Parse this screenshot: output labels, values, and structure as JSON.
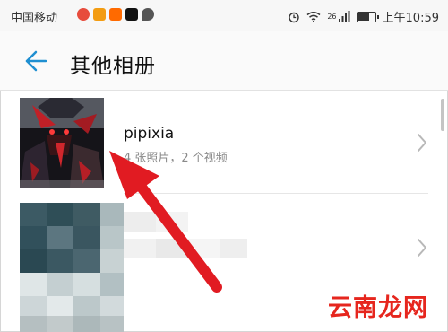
{
  "status_bar": {
    "carrier": "中国移动",
    "network": "26",
    "time": "上午10:59"
  },
  "header": {
    "back_icon": "back-arrow-icon",
    "title": "其他相册"
  },
  "albums": [
    {
      "name": "pipixia",
      "count": "4 张照片，2 个视频"
    },
    {
      "name": "",
      "count": ""
    }
  ],
  "watermark": "云南龙网",
  "colors": {
    "accent": "#1f8fd1",
    "annotation": "#e11b22",
    "watermark": "#e6261e"
  }
}
